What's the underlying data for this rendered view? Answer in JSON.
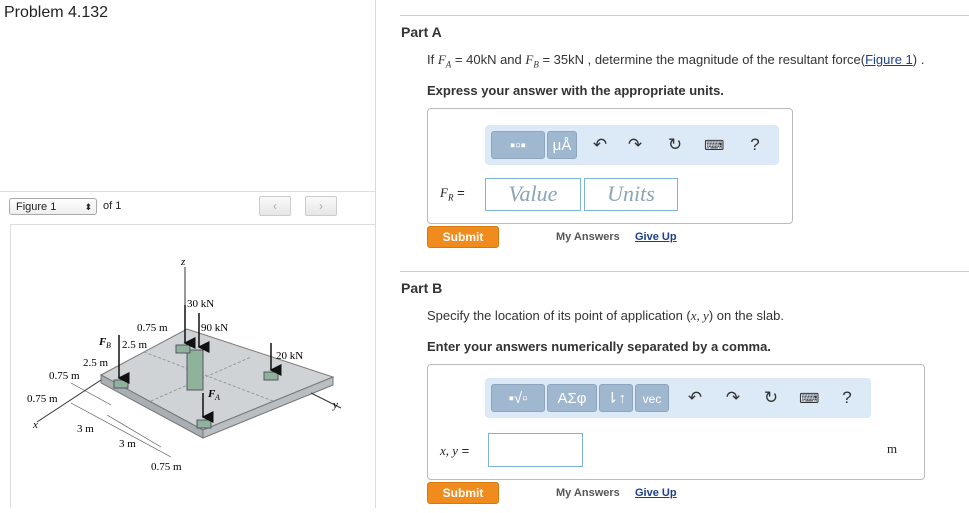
{
  "problem": {
    "title": "Problem 4.132"
  },
  "figure_nav": {
    "select_value": "Figure 1",
    "of_label": "of 1",
    "prev_icon": "chevron-left-icon",
    "next_icon": "chevron-right-icon"
  },
  "figure": {
    "axis_z": "z",
    "axis_x": "x",
    "axis_y": "y",
    "load_30": "30 kN",
    "load_90": "90 kN",
    "load_20": "20 kN",
    "label_fb": "F",
    "label_fb_sub": "B",
    "label_fa": "F",
    "label_fa_sub": "A",
    "dim_075_top": "0.75 m",
    "dim_25_top": "2.5 m",
    "dim_25_left": "2.5 m",
    "dim_075_left": "0.75 m",
    "dim_075_left2": "0.75 m",
    "dim_3_a": "3 m",
    "dim_3_b": "3 m",
    "dim_075_bottom": "0.75 m"
  },
  "partA": {
    "title": "Part A",
    "question_prefix": "If ",
    "fa_sym": "F",
    "fa_sub": "A",
    "fa_val": " = 40kN and ",
    "fb_sym": "F",
    "fb_sub": "B",
    "fb_val": " = 35kN , determine the magnitude of the resultant force(",
    "figure_link": "Figure 1",
    "question_suffix": ") .",
    "instruction": "Express your answer with the appropriate units.",
    "field_label_sym": "F",
    "field_label_sub": "R",
    "field_label_eq": " =",
    "value_placeholder": "Value",
    "units_placeholder": "Units",
    "toolbar": {
      "units_btn": "μÅ",
      "help": "?"
    },
    "submit": "Submit",
    "my_answers": "My Answers",
    "give_up": "Give Up"
  },
  "partB": {
    "title": "Part B",
    "question": "Specify the location of its point of application (",
    "question_vars": "x, y",
    "question_suffix": ") on the slab.",
    "instruction": "Enter your answers numerically separated by a comma.",
    "field_label": "x, y",
    "field_eq": " =",
    "unit": "m",
    "toolbar": {
      "greek": "ΑΣφ",
      "arrows": "⇂↑",
      "vec": "vec",
      "help": "?"
    },
    "submit": "Submit",
    "my_answers": "My Answers",
    "give_up": "Give Up"
  }
}
